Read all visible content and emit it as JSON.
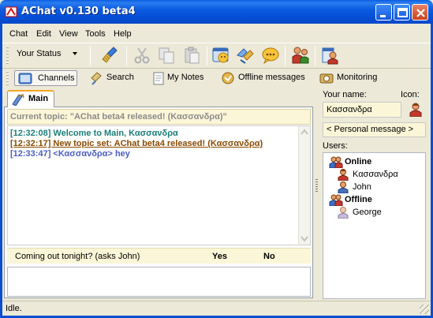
{
  "window": {
    "title": "AChat v0.130 beta4"
  },
  "menu": {
    "items": [
      "Chat",
      "Edit",
      "View",
      "Tools",
      "Help"
    ]
  },
  "toolbar": {
    "status_label": "Your Status"
  },
  "nav_tabs": {
    "channels": "Channels",
    "search": "Search",
    "my_notes": "My Notes",
    "offline_messages": "Offline messages",
    "monitoring": "Monitoring"
  },
  "channel": {
    "tab_label": "Main",
    "topic": "Current topic: \"AChat beta4 released! (Κασσανδρα)\"",
    "messages": [
      {
        "text": "[12:32:08] Welcome to Main, Κασσανδρα",
        "color": "#1a7f7a"
      },
      {
        "text": "[12:32:17] New topic set: AChat beta4 released! (Κασσανδρα)",
        "color": "#8a4a00"
      },
      {
        "text": "[12:33:47] <Κασσανδρα> hey",
        "color": "#4a5dc4"
      }
    ],
    "poll": {
      "question": "Coming out tonight? (asks John)",
      "yes": "Yes",
      "no": "No"
    },
    "input_value": ""
  },
  "profile": {
    "name_label": "Your name:",
    "icon_label": "Icon:",
    "name_value": "Κασσανδρα",
    "personal_message": "< Personal message >",
    "users_label": "Users:"
  },
  "users": {
    "online_label": "Online",
    "online": [
      "Κασσανδρα",
      "John"
    ],
    "offline_label": "Offline",
    "offline": [
      "George"
    ]
  },
  "status_bar": {
    "text": "Idle."
  },
  "colors": {
    "titlebar": "#0550d6",
    "window_bg": "#ece9d8",
    "topic_bg": "#fbf6d8",
    "tab_accent": "#f5a526"
  }
}
